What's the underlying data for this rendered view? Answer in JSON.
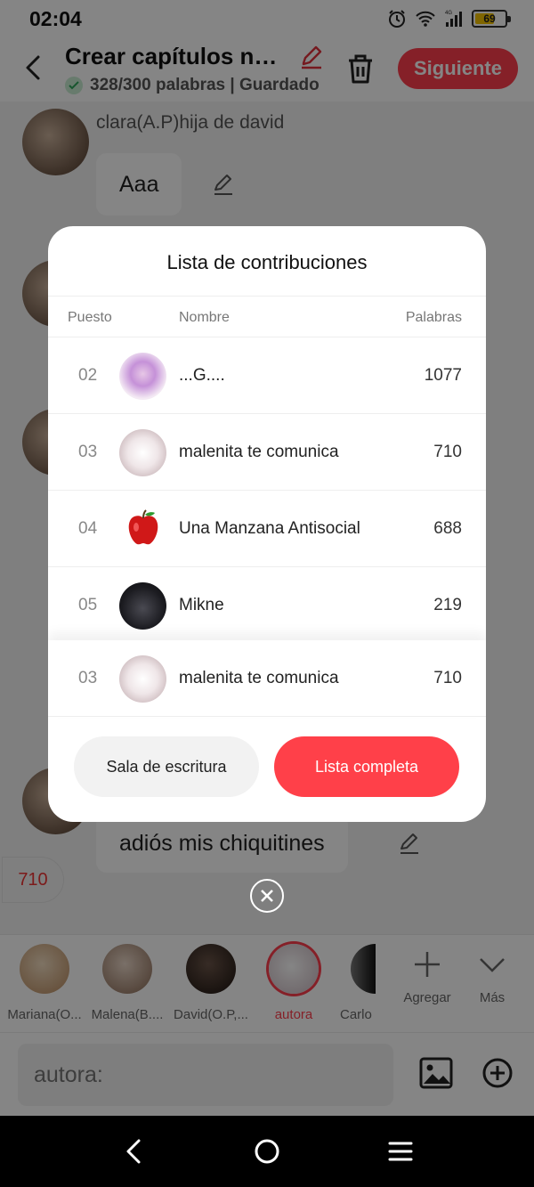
{
  "status_bar": {
    "time": "02:04",
    "battery": "69",
    "network": "4G"
  },
  "header": {
    "title": "Crear capítulos nue...",
    "subtitle": "328/300 palabras | Guardado",
    "next_label": "Siguiente"
  },
  "chat": {
    "messages": [
      {
        "author": "clara(A.P)hija de david",
        "text": "Aaa"
      },
      {
        "author": "",
        "text": "adiós mis chiquitines"
      }
    ],
    "word_chip": "710"
  },
  "modal": {
    "title": "Lista de contribuciones",
    "columns": {
      "rank": "Puesto",
      "name": "Nombre",
      "words": "Palabras"
    },
    "rows": [
      {
        "rank": "02",
        "name": "...G....",
        "words": "1077",
        "avatar": "pink-anime-avatar"
      },
      {
        "rank": "03",
        "name": "malenita te comunica",
        "words": "710",
        "avatar": "white-fluffy-avatar"
      },
      {
        "rank": "04",
        "name": "Una Manzana Antisocial",
        "words": "688",
        "avatar": "red-apple-avatar"
      },
      {
        "rank": "05",
        "name": "Mikne",
        "words": "219",
        "avatar": "dark-figure-avatar"
      }
    ],
    "self_row": {
      "rank": "03",
      "name": "malenita te comunica",
      "words": "710",
      "avatar": "white-fluffy-avatar"
    },
    "btn_room": "Sala de escritura",
    "btn_full_list": "Lista completa"
  },
  "characters": [
    {
      "name": "Mariana(O...",
      "color": "#d8b48c"
    },
    {
      "name": "Malena(B....",
      "color": "#c9a48a"
    },
    {
      "name": "David(O.P,...",
      "color": "#3a2a22"
    },
    {
      "name": "autora",
      "color": "#e9dfe3",
      "active": true
    },
    {
      "name": "Carlo",
      "color": "#222222"
    }
  ],
  "tools": {
    "add": "Agregar",
    "more": "Más"
  },
  "input": {
    "placeholder": "autora:"
  },
  "colors": {
    "accent": "#ff3f4d",
    "button_red": "#ff4049"
  }
}
